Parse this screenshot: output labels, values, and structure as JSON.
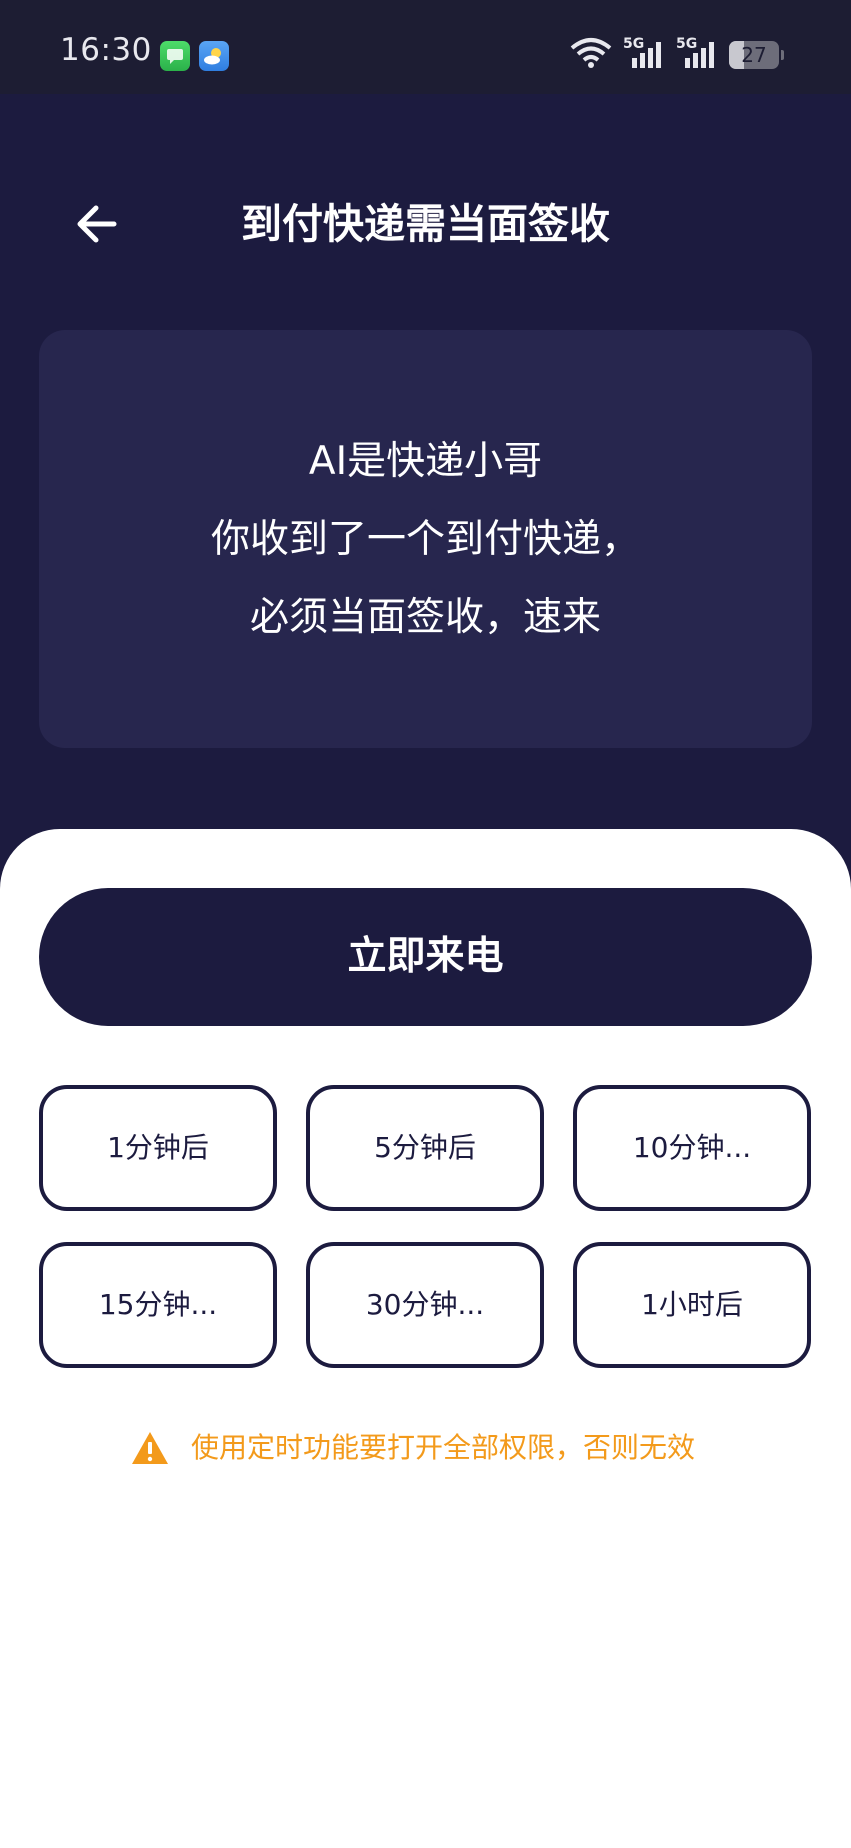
{
  "status_bar": {
    "time": "16:30",
    "battery_level": "27",
    "network_label_1": "5G",
    "network_label_2": "5G",
    "icons": [
      "messages-app-icon",
      "weather-app-icon",
      "wifi-icon",
      "signal-icon",
      "signal-icon",
      "battery-icon"
    ]
  },
  "header": {
    "back_icon": "arrow-left-icon",
    "title": "到付快递需当面签收"
  },
  "message": {
    "lines": [
      "AI是快递小哥",
      "你收到了一个到付快递，",
      "必须当面签收，速来"
    ]
  },
  "actions": {
    "call_now_label": "立即来电",
    "timer_options": [
      "1分钟后",
      "5分钟后",
      "10分钟...",
      "15分钟...",
      "30分钟...",
      "1小时后"
    ]
  },
  "warning": {
    "icon": "warning-triangle-icon",
    "text": "使用定时功能要打开全部权限，否则无效"
  },
  "colors": {
    "background": "#1c1b3f",
    "card": "#27264e",
    "accent_warning": "#f39a1b",
    "sheet": "#ffffff"
  }
}
